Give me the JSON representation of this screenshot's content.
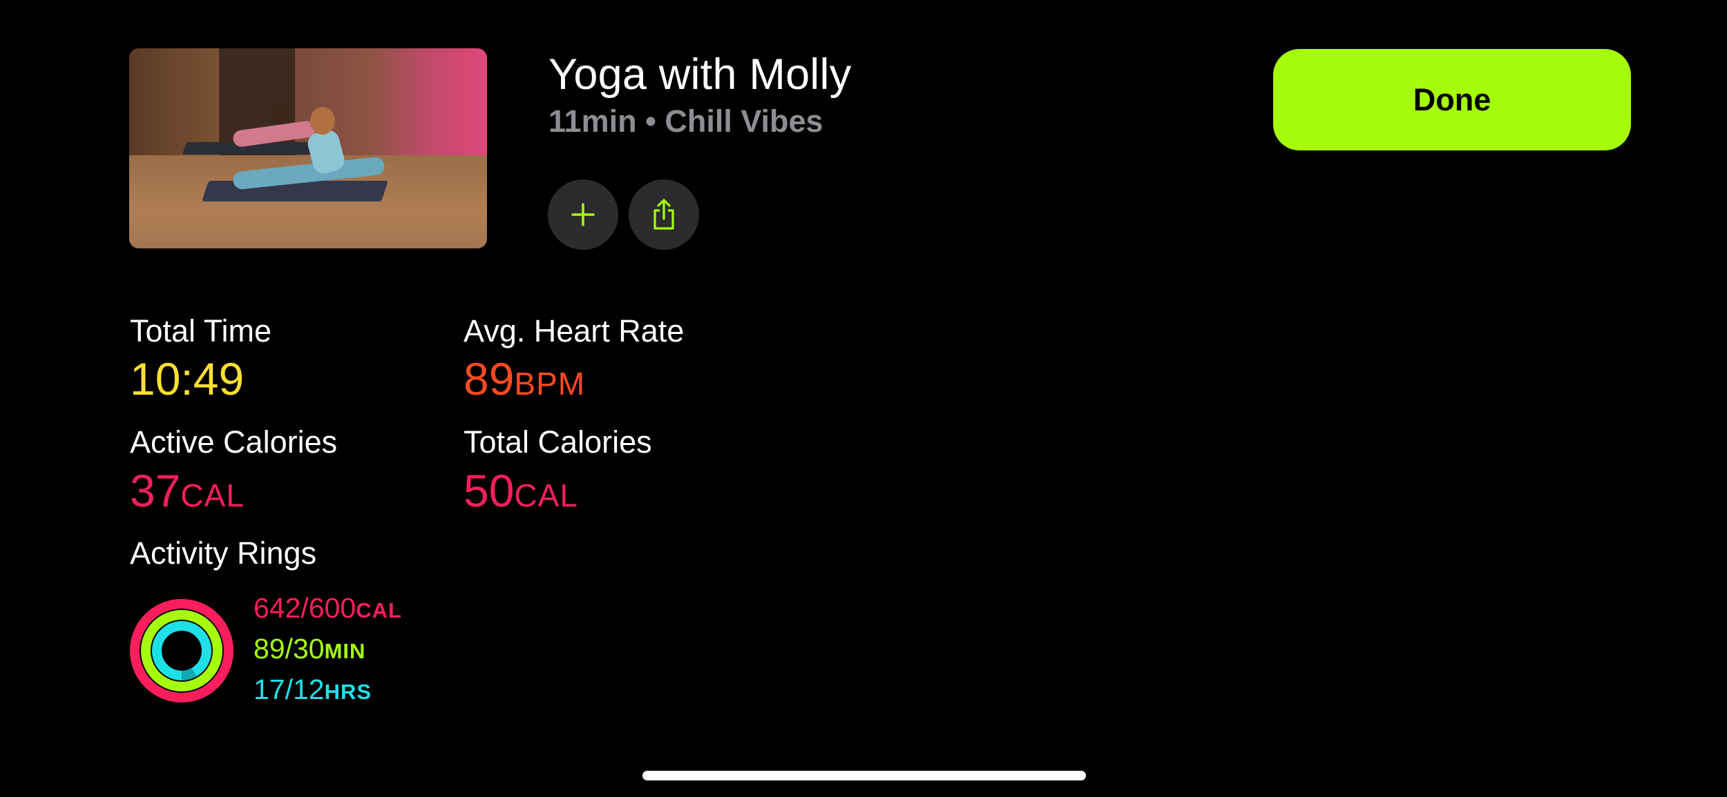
{
  "workout": {
    "title": "Yoga with Molly",
    "subtitle": "11min • Chill Vibes",
    "thumbnail_icon": "yoga-video-thumbnail"
  },
  "actions": {
    "add_icon": "plus-icon",
    "share_icon": "share-icon",
    "done_label": "Done"
  },
  "metrics": {
    "total_time": {
      "label": "Total Time",
      "value": "10:49",
      "unit": "",
      "color": "#ffe032"
    },
    "avg_heart_rate": {
      "label": "Avg. Heart Rate",
      "value": "89",
      "unit": "BPM",
      "color": "#ff4b22"
    },
    "active_calories": {
      "label": "Active Calories",
      "value": "37",
      "unit": "CAL",
      "color": "#fa1f5c"
    },
    "total_calories": {
      "label": "Total Calories",
      "value": "50",
      "unit": "CAL",
      "color": "#fa1f5c"
    }
  },
  "activity_rings": {
    "label": "Activity Rings",
    "move": {
      "value": "642/600",
      "unit": "CAL",
      "color": "#fa1f5c",
      "progress": 1.07
    },
    "exercise": {
      "value": "89/30",
      "unit": "MIN",
      "color": "#a6fd0b",
      "progress": 2.97
    },
    "stand": {
      "value": "17/12",
      "unit": "HRS",
      "color": "#1ee1e8",
      "progress": 1.42
    }
  },
  "colors": {
    "accent": "#a6fd0b",
    "background": "#000000",
    "secondary_text": "#8d8d93",
    "button_bg": "#2c2c2e"
  }
}
